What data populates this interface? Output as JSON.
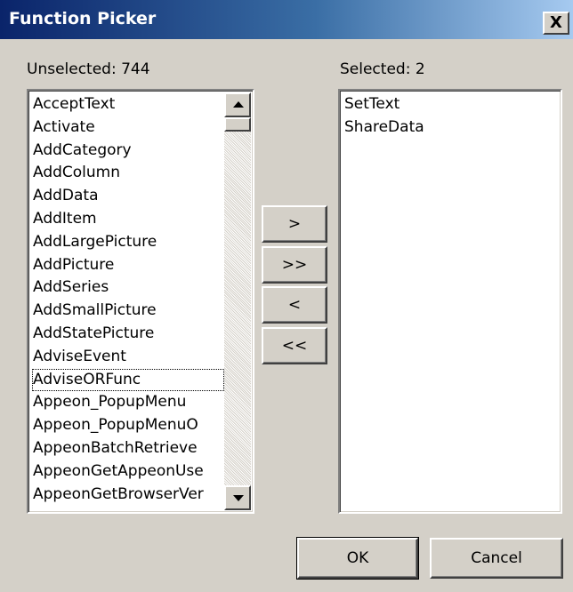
{
  "window": {
    "title": "Function Picker",
    "close_label": "X"
  },
  "unselected": {
    "label": "Unselected: 744",
    "items": [
      "AcceptText",
      "Activate",
      "AddCategory",
      "AddColumn",
      "AddData",
      "AddItem",
      "AddLargePicture",
      "AddPicture",
      "AddSeries",
      "AddSmallPicture",
      "AddStatePicture",
      "AdviseEvent",
      "AdviseORFunc",
      "Appeon_PopupMenu",
      "Appeon_PopupMenuO",
      "AppeonBatchRetrieve",
      "AppeonGetAppeonUse",
      "AppeonGetBrowserVer"
    ],
    "focused_item": "AdviseORFunc"
  },
  "selected": {
    "label": "Selected: 2",
    "items": [
      "SetText",
      "ShareData"
    ]
  },
  "transfer": {
    "add_one": ">",
    "add_all": ">>",
    "remove_one": "<",
    "remove_all": "<<"
  },
  "footer": {
    "ok_label": "OK",
    "cancel_label": "Cancel"
  }
}
